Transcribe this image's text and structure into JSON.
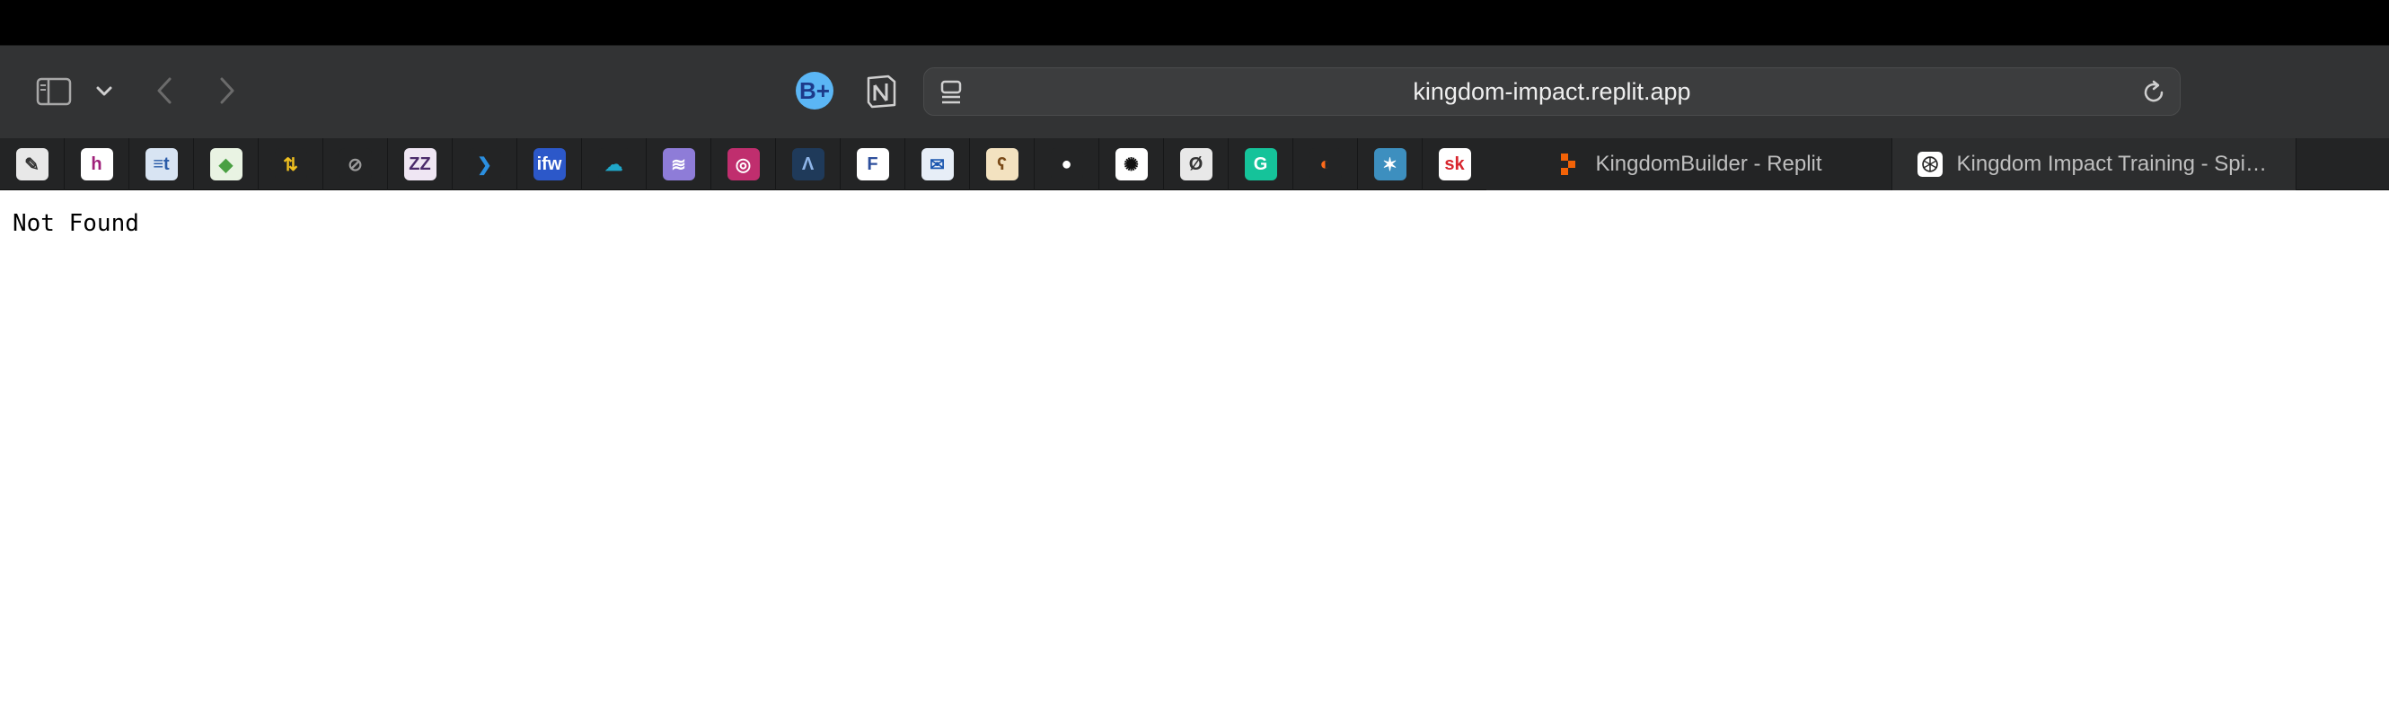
{
  "browser": {
    "address_bar": {
      "url": "kingdom-impact.replit.app"
    },
    "toolbar": {
      "sidebar_icon": "sidebar-icon",
      "chevron_icon": "chevron-down-icon",
      "back_icon": "back-icon",
      "forward_icon": "forward-icon",
      "extensions": [
        {
          "name": "bplus-extension",
          "glyph": "B+"
        },
        {
          "name": "notion-extension",
          "glyph": "N"
        }
      ]
    },
    "pinned_tabs": [
      {
        "name": "pin-tab-pencil",
        "glyph": "✎",
        "bg": "#e8e8e8",
        "fg": "#333333"
      },
      {
        "name": "pin-tab-h",
        "glyph": "h",
        "bg": "#ffffff",
        "fg": "#a0207a"
      },
      {
        "name": "pin-tab-et",
        "glyph": "≡t",
        "bg": "#d8e4f3",
        "fg": "#2a5ba8"
      },
      {
        "name": "pin-tab-green",
        "glyph": "◆",
        "bg": "#e9f3e3",
        "fg": "#4aa043"
      },
      {
        "name": "pin-tab-arrows",
        "glyph": "⇅",
        "bg": "#232425",
        "fg": "#f0c020"
      },
      {
        "name": "pin-tab-compass",
        "glyph": "⊘",
        "bg": "#232425",
        "fg": "#9a9a9a"
      },
      {
        "name": "pin-tab-zz",
        "glyph": "ZZ",
        "bg": "#efe6f3",
        "fg": "#4a2a6a"
      },
      {
        "name": "pin-tab-chevron",
        "glyph": "❯",
        "bg": "#232425",
        "fg": "#2b8fe0"
      },
      {
        "name": "pin-tab-ifw",
        "glyph": "ifw",
        "bg": "#2c58c9",
        "fg": "#ffffff"
      },
      {
        "name": "pin-tab-cloud",
        "glyph": "☁",
        "bg": "#232425",
        "fg": "#1fa6c8"
      },
      {
        "name": "pin-tab-spotify",
        "glyph": "≋",
        "bg": "#8e7cd8",
        "fg": "#ffffff"
      },
      {
        "name": "pin-tab-circle",
        "glyph": "◎",
        "bg": "#c02e6e",
        "fg": "#ffffff"
      },
      {
        "name": "pin-tab-lambda",
        "glyph": "Λ",
        "bg": "#1f3a5a",
        "fg": "#8fb5e8"
      },
      {
        "name": "pin-tab-f",
        "glyph": "F",
        "bg": "#ffffff",
        "fg": "#2d4f9c"
      },
      {
        "name": "pin-tab-mail",
        "glyph": "✉",
        "bg": "#e7eef7",
        "fg": "#1c58b0"
      },
      {
        "name": "pin-tab-bear",
        "glyph": "ʕ",
        "bg": "#f3e2c0",
        "fg": "#7a4a18"
      },
      {
        "name": "pin-tab-apple",
        "glyph": "●",
        "bg": "#232425",
        "fg": "#ffffff"
      },
      {
        "name": "pin-tab-spark",
        "glyph": "✺",
        "bg": "#ffffff",
        "fg": "#111111"
      },
      {
        "name": "pin-tab-slash",
        "glyph": "Ø",
        "bg": "#e8e8e8",
        "fg": "#333333"
      },
      {
        "name": "pin-tab-grammarly",
        "glyph": "G",
        "bg": "#15c39a",
        "fg": "#ffffff"
      },
      {
        "name": "pin-tab-orange",
        "glyph": "◐",
        "bg": "#232425",
        "fg": "#ff6a1a"
      },
      {
        "name": "pin-tab-star",
        "glyph": "✶",
        "bg": "#3d8fbf",
        "fg": "#ffffff"
      },
      {
        "name": "pin-tab-sk",
        "glyph": "sk",
        "bg": "#ffffff",
        "fg": "#d8262e"
      }
    ],
    "tabs": [
      {
        "label": "KingdomBuilder - Replit",
        "icon": "replit-icon"
      },
      {
        "label": "Kingdom Impact Training - Spiri...",
        "icon": "openai-icon"
      }
    ]
  },
  "page": {
    "message": "Not Found"
  }
}
